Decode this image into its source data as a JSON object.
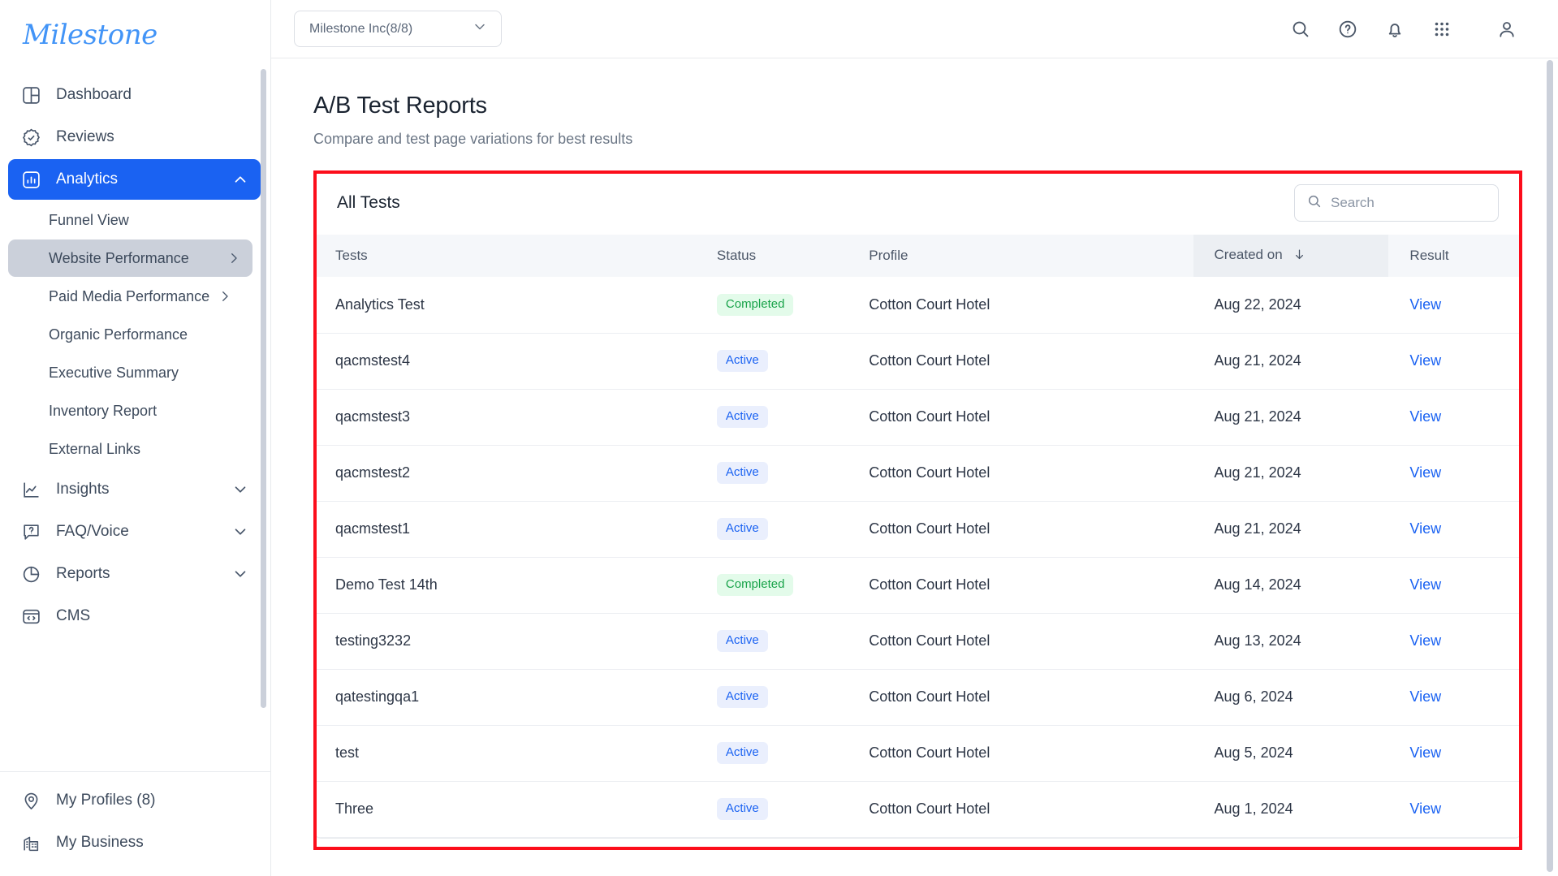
{
  "sidebar": {
    "brand": "Milestone",
    "items": [
      {
        "label": "Dashboard",
        "icon": "dashboard-icon",
        "caret": ""
      },
      {
        "label": "Reviews",
        "icon": "check-badge-icon",
        "caret": ""
      },
      {
        "label": "Analytics",
        "icon": "bar-chart-icon",
        "caret": "chevron-up-icon"
      }
    ],
    "analytics_children": [
      {
        "label": "Funnel View",
        "chevron": false
      },
      {
        "label": "Website Performance",
        "chevron": true
      },
      {
        "label": "Paid Media Performance",
        "chevron": true
      },
      {
        "label": "Organic Performance",
        "chevron": false
      },
      {
        "label": "Executive Summary",
        "chevron": false
      },
      {
        "label": "Inventory Report",
        "chevron": false
      },
      {
        "label": "External Links",
        "chevron": false
      }
    ],
    "items_after": [
      {
        "label": "Insights",
        "icon": "line-chart-icon",
        "caret": "chevron-down-icon"
      },
      {
        "label": "FAQ/Voice",
        "icon": "question-chat-icon",
        "caret": "chevron-down-icon"
      },
      {
        "label": "Reports",
        "icon": "pie-chart-icon",
        "caret": "chevron-down-icon"
      },
      {
        "label": "CMS",
        "icon": "code-window-icon",
        "caret": ""
      }
    ],
    "bottom_items": [
      {
        "label": "My Profiles (8)",
        "icon": "location-pin-icon"
      },
      {
        "label": "My Business",
        "icon": "building-icon"
      }
    ],
    "selected_child": "Website Performance",
    "active_item": "Analytics"
  },
  "topbar": {
    "profile_selector": "Milestone Inc(8/8)",
    "icons": [
      "search-icon",
      "help-circle-icon",
      "bell-icon",
      "grid-apps-icon",
      "user-avatar-icon"
    ]
  },
  "page": {
    "title": "A/B Test Reports",
    "subtitle": "Compare and test page variations for best results"
  },
  "card": {
    "title": "All Tests",
    "search_placeholder": "Search",
    "search_value": ""
  },
  "table": {
    "columns": [
      "Tests",
      "Status",
      "Profile",
      "Created on",
      "Result"
    ],
    "sorted_column": "Created on",
    "sort_direction": "desc",
    "rows": [
      {
        "test": "Analytics Test",
        "status": "Completed",
        "profile": "Cotton Court Hotel",
        "created": "Aug 22, 2024",
        "result": "View"
      },
      {
        "test": "qacmstest4",
        "status": "Active",
        "profile": "Cotton Court Hotel",
        "created": "Aug 21, 2024",
        "result": "View"
      },
      {
        "test": "qacmstest3",
        "status": "Active",
        "profile": "Cotton Court Hotel",
        "created": "Aug 21, 2024",
        "result": "View"
      },
      {
        "test": "qacmstest2",
        "status": "Active",
        "profile": "Cotton Court Hotel",
        "created": "Aug 21, 2024",
        "result": "View"
      },
      {
        "test": "qacmstest1",
        "status": "Active",
        "profile": "Cotton Court Hotel",
        "created": "Aug 21, 2024",
        "result": "View"
      },
      {
        "test": "Demo Test 14th",
        "status": "Completed",
        "profile": "Cotton Court Hotel",
        "created": "Aug 14, 2024",
        "result": "View"
      },
      {
        "test": "testing3232",
        "status": "Active",
        "profile": "Cotton Court Hotel",
        "created": "Aug 13, 2024",
        "result": "View"
      },
      {
        "test": "qatestingqa1",
        "status": "Active",
        "profile": "Cotton Court Hotel",
        "created": "Aug 6, 2024",
        "result": "View"
      },
      {
        "test": "test",
        "status": "Active",
        "profile": "Cotton Court Hotel",
        "created": "Aug 5, 2024",
        "result": "View"
      },
      {
        "test": "Three",
        "status": "Active",
        "profile": "Cotton Court Hotel",
        "created": "Aug 1, 2024",
        "result": "View"
      }
    ]
  },
  "colors": {
    "accent": "#1a62f2",
    "brand": "#4294f7",
    "completed_bg": "#e3fbea",
    "completed_fg": "#19a34a",
    "active_bg": "#eaeffd",
    "active_fg": "#1a62f2",
    "highlight_border": "#fc0d1b"
  }
}
